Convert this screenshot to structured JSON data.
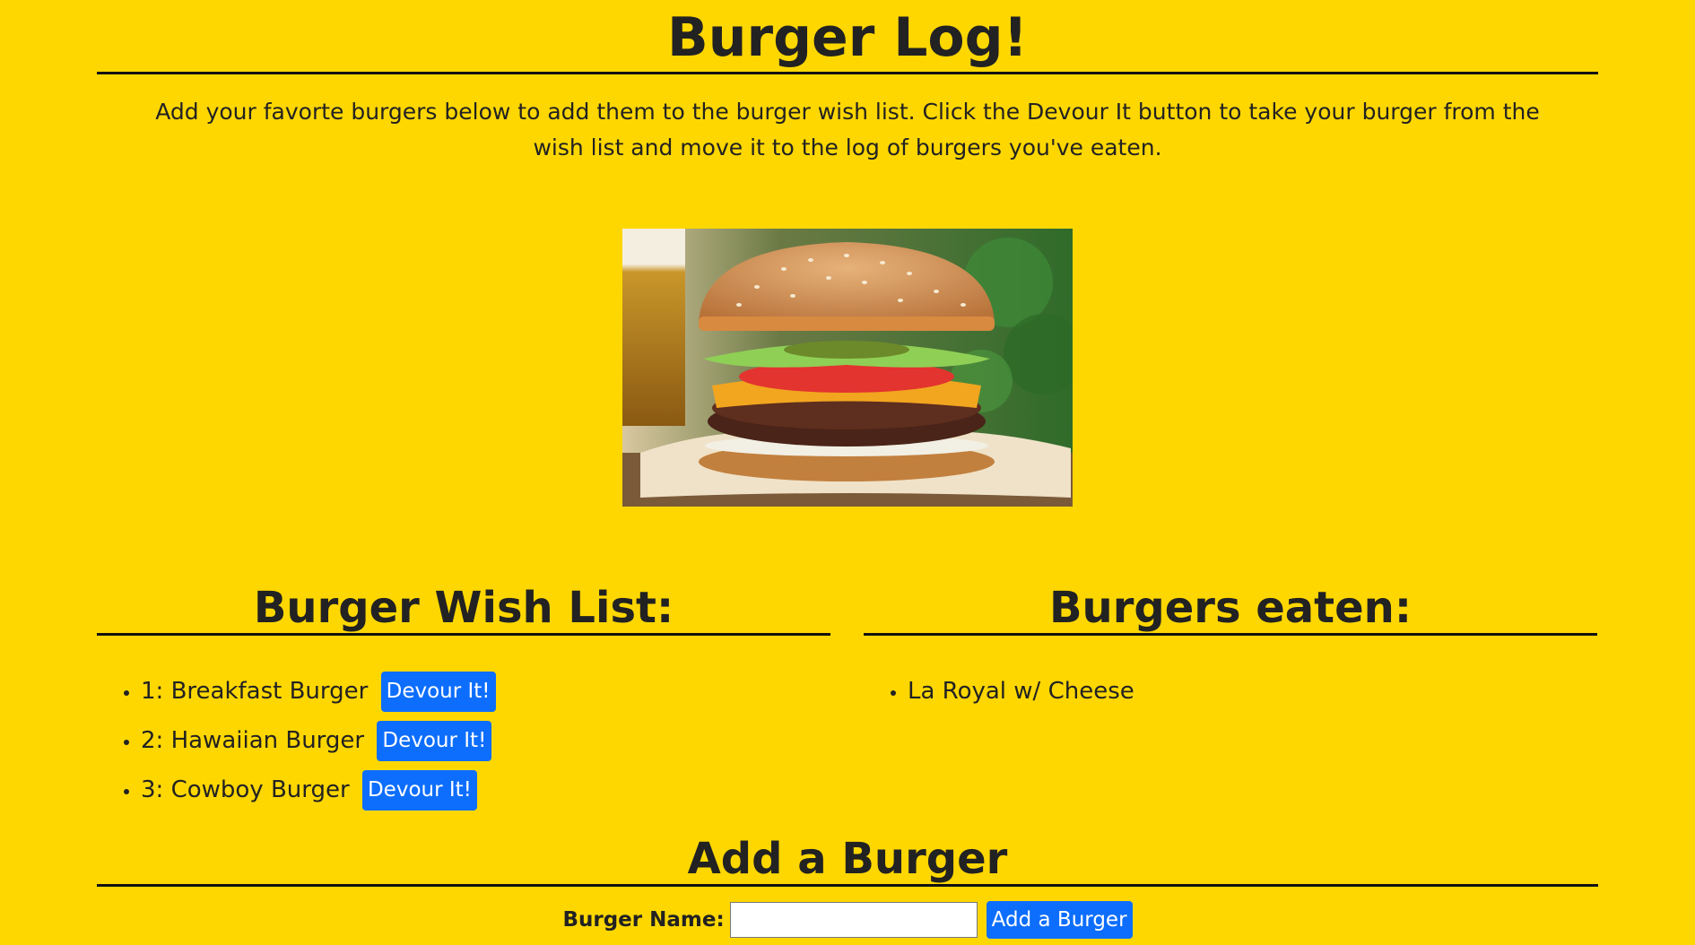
{
  "header": {
    "title": "Burger Log!",
    "intro": "Add your favorte burgers below to add them to the burger wish list. Click the Devour It button to take your burger from the wish list and move it to the log of burgers you've eaten."
  },
  "wish_list": {
    "heading": "Burger Wish List:",
    "devour_label": "Devour It!",
    "items": [
      {
        "label": "1: Breakfast Burger"
      },
      {
        "label": "2: Hawaiian Burger"
      },
      {
        "label": "3: Cowboy Burger"
      }
    ]
  },
  "eaten": {
    "heading": "Burgers eaten:",
    "items": [
      {
        "label": "La Royal w/ Cheese"
      }
    ]
  },
  "add_form": {
    "heading": "Add a Burger",
    "name_label": "Burger Name:",
    "name_value": "",
    "submit_label": "Add a Burger"
  }
}
